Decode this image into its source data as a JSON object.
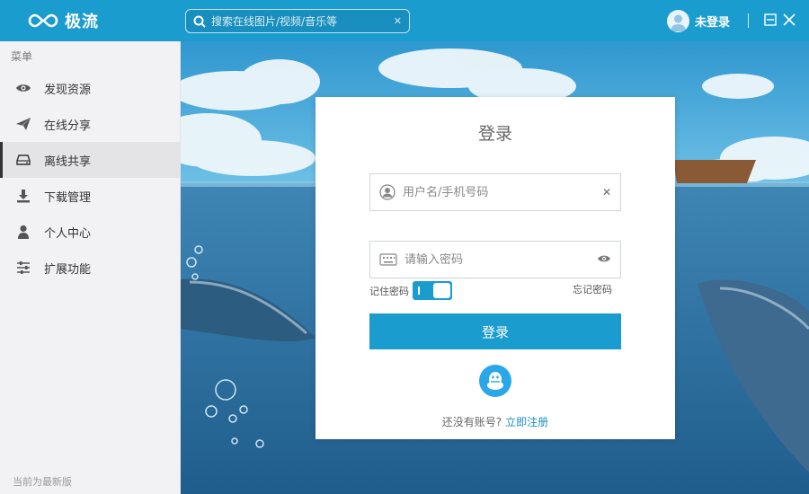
{
  "app": {
    "logo_text": "极流",
    "search_placeholder": "搜索在线图片/视频/音乐等",
    "user_label": "未登录"
  },
  "sidebar": {
    "title": "菜单",
    "items": [
      {
        "label": "发现资源",
        "icon": "eye-icon"
      },
      {
        "label": "在线分享",
        "icon": "paper-plane-icon"
      },
      {
        "label": "离线共享",
        "icon": "hard-drive-icon",
        "active": true
      },
      {
        "label": "下载管理",
        "icon": "download-icon"
      },
      {
        "label": "个人中心",
        "icon": "user-icon"
      },
      {
        "label": "扩展功能",
        "icon": "sliders-icon"
      }
    ],
    "version_text": "当前为最新版"
  },
  "login": {
    "title": "登录",
    "username_placeholder": "用户名/手机号码",
    "password_placeholder": "请输入密码",
    "remember_label": "记住密码",
    "remember_on": true,
    "forgot_label": "忘记密码",
    "submit_label": "登录",
    "no_account_text": "还没有账号?",
    "register_label": "立即注册"
  },
  "colors": {
    "accent": "#1b9ccf",
    "sidebar_bg": "#f2f2f4",
    "sky": "#3b9fd1",
    "sea": "#2f6f9c"
  }
}
